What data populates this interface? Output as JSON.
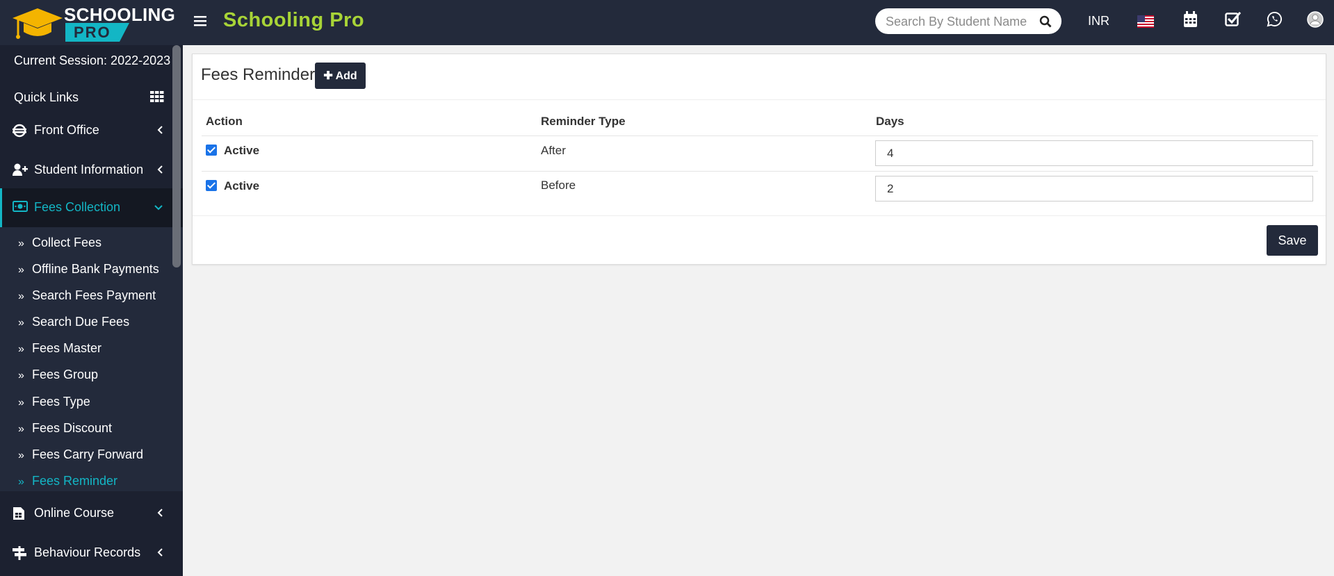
{
  "app": {
    "logo_line1": "SCHOOLING",
    "logo_line2": "PRO",
    "title": "Schooling Pro",
    "accent_color": "#13b6c5",
    "title_color": "#a8d437"
  },
  "header": {
    "search_placeholder": "Search By Student Name",
    "currency": "INR",
    "icons": [
      "menu-icon",
      "search-icon",
      "us-flag-icon",
      "calendar-icon",
      "task-check-icon",
      "whatsapp-icon",
      "user-avatar-icon"
    ]
  },
  "sidebar": {
    "session": "Current Session: 2022-2023",
    "quick_links": "Quick Links",
    "menu": [
      {
        "label": "Front Office",
        "icon": "front-office-icon"
      },
      {
        "label": "Student Information",
        "icon": "user-plus-icon"
      },
      {
        "label": "Fees Collection",
        "icon": "money-icon"
      },
      {
        "label": "Online Course",
        "icon": "course-icon"
      },
      {
        "label": "Behaviour Records",
        "icon": "signpost-icon"
      }
    ],
    "fees_submenu": [
      "Collect Fees",
      "Offline Bank Payments",
      "Search Fees Payment",
      "Search Due Fees",
      "Fees Master",
      "Fees Group",
      "Fees Type",
      "Fees Discount",
      "Fees Carry Forward",
      "Fees Reminder"
    ]
  },
  "main": {
    "title": "Fees Reminder",
    "add_label": "Add",
    "columns": [
      "Action",
      "Reminder Type",
      "Days"
    ],
    "rows": [
      {
        "status": "Active",
        "checked": true,
        "type": "After",
        "days": "4"
      },
      {
        "status": "Active",
        "checked": true,
        "type": "Before",
        "days": "2"
      }
    ],
    "save_label": "Save"
  }
}
